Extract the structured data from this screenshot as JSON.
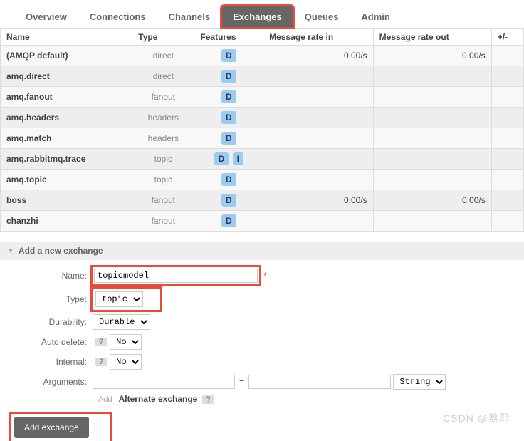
{
  "tabs": {
    "items": [
      {
        "label": "Overview"
      },
      {
        "label": "Connections"
      },
      {
        "label": "Channels"
      },
      {
        "label": "Exchanges"
      },
      {
        "label": "Queues"
      },
      {
        "label": "Admin"
      }
    ],
    "active_index": 3
  },
  "table": {
    "headers": [
      "Name",
      "Type",
      "Features",
      "Message rate in",
      "Message rate out",
      "+/-"
    ],
    "rows": [
      {
        "name": "(AMQP default)",
        "type": "direct",
        "features": [
          "D"
        ],
        "rate_in": "0.00/s",
        "rate_out": "0.00/s"
      },
      {
        "name": "amq.direct",
        "type": "direct",
        "features": [
          "D"
        ],
        "rate_in": "",
        "rate_out": ""
      },
      {
        "name": "amq.fanout",
        "type": "fanout",
        "features": [
          "D"
        ],
        "rate_in": "",
        "rate_out": ""
      },
      {
        "name": "amq.headers",
        "type": "headers",
        "features": [
          "D"
        ],
        "rate_in": "",
        "rate_out": ""
      },
      {
        "name": "amq.match",
        "type": "headers",
        "features": [
          "D"
        ],
        "rate_in": "",
        "rate_out": ""
      },
      {
        "name": "amq.rabbitmq.trace",
        "type": "topic",
        "features": [
          "D",
          "I"
        ],
        "rate_in": "",
        "rate_out": ""
      },
      {
        "name": "amq.topic",
        "type": "topic",
        "features": [
          "D"
        ],
        "rate_in": "",
        "rate_out": ""
      },
      {
        "name": "boss",
        "type": "fanout",
        "features": [
          "D"
        ],
        "rate_in": "0.00/s",
        "rate_out": "0.00/s"
      },
      {
        "name": "chanzhi",
        "type": "fanout",
        "features": [
          "D"
        ],
        "rate_in": "",
        "rate_out": ""
      }
    ]
  },
  "section": {
    "title": "Add a new exchange"
  },
  "form": {
    "name_label": "Name:",
    "name_value": "topicmodel",
    "asterisk": "*",
    "type_label": "Type:",
    "type_value": "topic",
    "durability_label": "Durability:",
    "durability_value": "Durable",
    "autodelete_label": "Auto delete:",
    "autodelete_value": "No",
    "internal_label": "Internal:",
    "internal_value": "No",
    "arguments_label": "Arguments:",
    "arguments_key": "",
    "arguments_eq": "=",
    "arguments_val": "",
    "arguments_type": "String",
    "add_label": "Add",
    "alternate_label": "Alternate exchange",
    "help": "?",
    "submit_label": "Add exchange"
  },
  "watermark": "CSDN @熬耶"
}
